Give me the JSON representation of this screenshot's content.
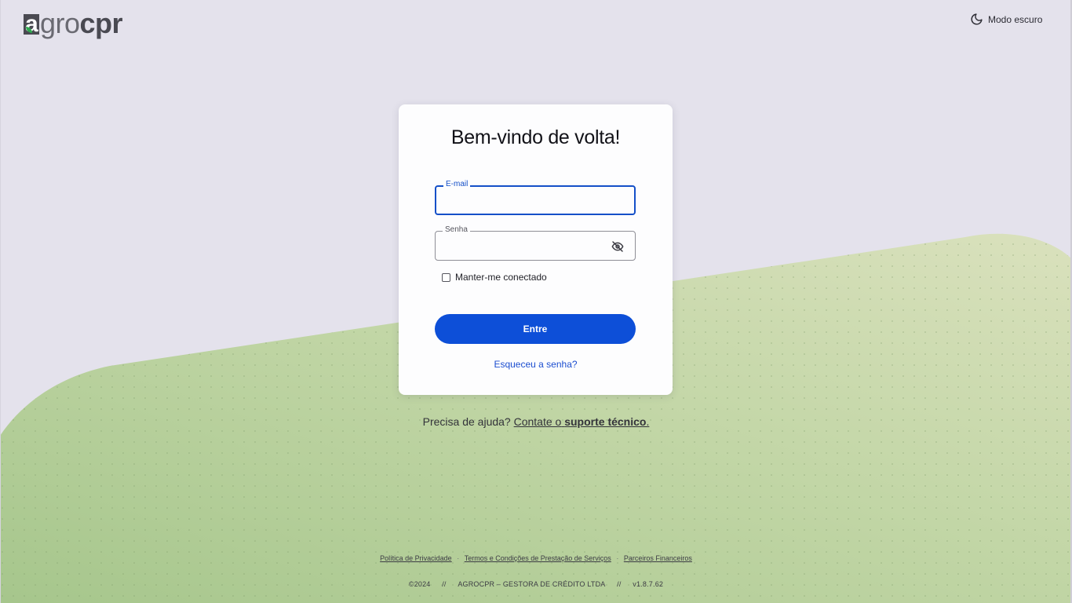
{
  "brand": {
    "logo_letter": "a",
    "logo_thin": "gro",
    "logo_bold": "cpr"
  },
  "header": {
    "theme_toggle_label": "Modo escuro",
    "theme_icon": "moon-icon"
  },
  "login": {
    "title": "Bem-vindo de volta!",
    "email": {
      "label": "E-mail",
      "value": ""
    },
    "password": {
      "label": "Senha",
      "value": "",
      "icon": "eye-off-icon"
    },
    "remember_label": "Manter-me conectado",
    "remember_checked": false,
    "submit_label": "Entre",
    "forgot_label": "Esqueceu a senha?"
  },
  "help": {
    "prefix": "Precisa de ajuda?",
    "link_prefix": "Contate o",
    "link_bold": "suporte técnico",
    "suffix": "."
  },
  "footer": {
    "links": [
      "Política de Privacidade",
      "Termos e Condições de Prestação de Serviços",
      "Parceiros Financeiros"
    ],
    "separator": "·",
    "copyright": "©2024",
    "meta_separator": "//",
    "company": "AGROCPR – GESTORA DE CRÉDITO LTDA",
    "version": "v1.8.7.62"
  },
  "colors": {
    "page_bg": "#e4e2ec",
    "primary": "#0d4fd8",
    "wave_green": "#a9c98f",
    "wave_light": "#d8e0b9"
  }
}
